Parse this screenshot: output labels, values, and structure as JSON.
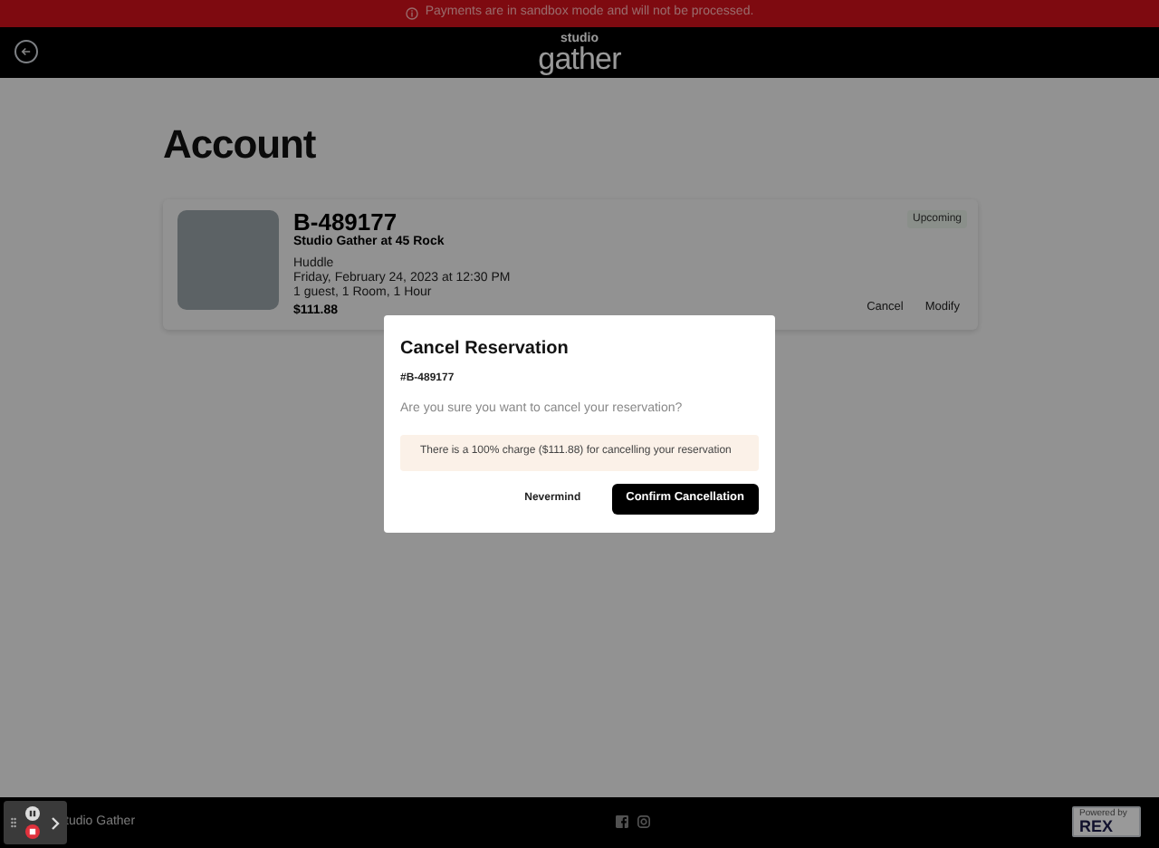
{
  "banner": {
    "text": "Payments are in sandbox mode and will not be processed."
  },
  "header": {
    "logo_top": "studio",
    "logo_main": "gather"
  },
  "page": {
    "title": "Account"
  },
  "reservation": {
    "code": "B-489177",
    "venue": "Studio Gather at 45 Rock",
    "room": "Huddle",
    "datetime": "Friday, February 24, 2023 at 12:30 PM",
    "details": "1 guest, 1 Room, 1 Hour",
    "price": "$111.88",
    "status": "Upcoming",
    "actions": [
      "Cancel",
      "Modify"
    ]
  },
  "dialog": {
    "title": "Cancel Reservation",
    "code": "#B-489177",
    "question": "Are you sure you want to cancel your reservation?",
    "notice": "There is a 100% charge ($111.88) for cancelling your reservation",
    "buttons": [
      {
        "label": "Nevermind",
        "kind": "secondary"
      },
      {
        "label": "Confirm Cancellation",
        "kind": "primary"
      }
    ]
  },
  "footer": {
    "brand": "tudio Gather",
    "powered_by": "Powered by",
    "powered_logo": "REX"
  }
}
